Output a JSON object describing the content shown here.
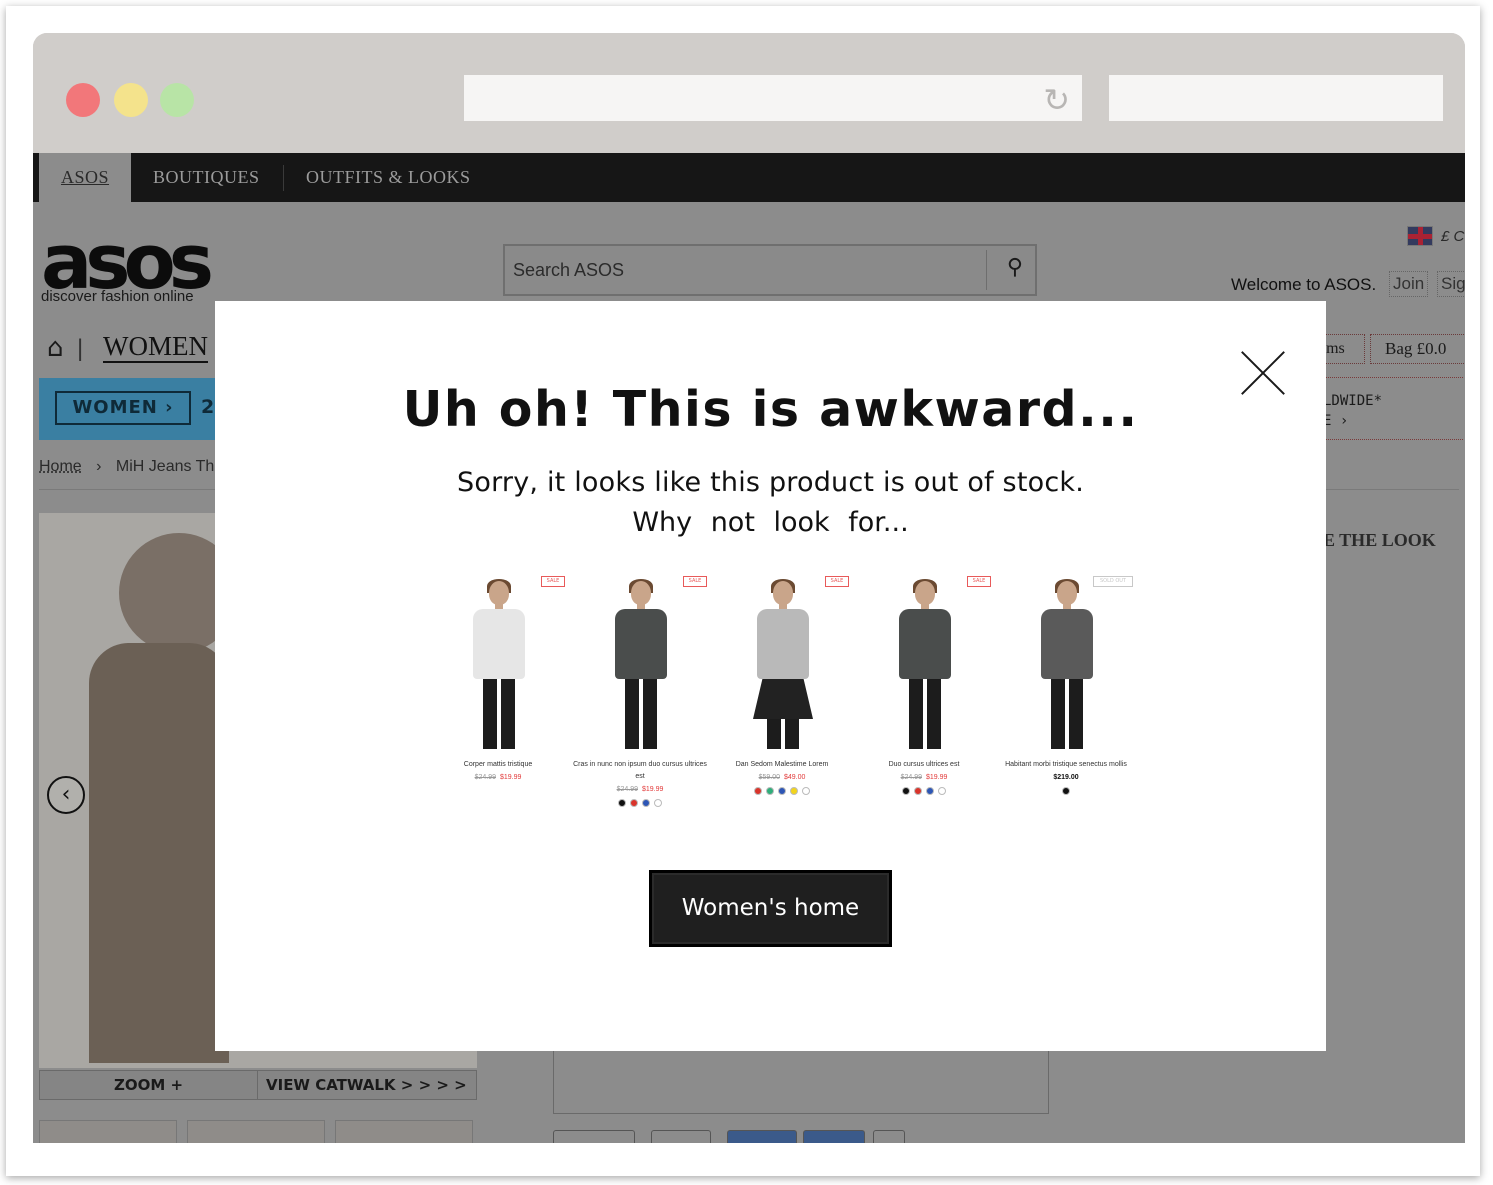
{
  "browser": {
    "reload_glyph": "↻"
  },
  "site": {
    "top_nav": [
      "ASOS",
      "BOUTIQUES",
      "OUTFITS & LOOKS"
    ],
    "logo": "asos",
    "tagline": "discover fashion online",
    "search_placeholder": "Search ASOS",
    "currency": "£ C",
    "welcome": "Welcome to ASOS.",
    "join": "Join",
    "sign_in": "Sig",
    "nav_women": "WOMEN",
    "banner_button": "WOMEN ›",
    "banner_number": "2",
    "breadcrumb": [
      "Home",
      "MiH Jeans The"
    ],
    "items_label": "ems",
    "bag_label": "Bag  £0.0",
    "shipping_line1": "LDWIDE*",
    "shipping_line2": "E ›",
    "shop_the_look": "E THE LOOK",
    "zoom_label": "ZOOM +",
    "catwalk_label": "VIEW CATWALK > > > >",
    "prev_arrow": "‹"
  },
  "modal": {
    "title": "Uh oh! This is awkward...",
    "subtitle_line1": "Sorry, it looks like this product is out of stock.",
    "subtitle_line2": "Why not look for...",
    "cta_label": "Women's home",
    "products": [
      {
        "name": "Corper mattis tristique",
        "old_price": "$24.99",
        "price": "$19.99",
        "tag": "SALE",
        "top_color": "#e6e6e6",
        "swatches": []
      },
      {
        "name": "Cras in nunc non ipsum duo cursus ultrices est",
        "old_price": "$24.99",
        "price": "$19.99",
        "tag": "SALE",
        "top_color": "#4a4d4c",
        "swatches": [
          "#111111",
          "#d9342b",
          "#2d56b5",
          "#ffffff"
        ]
      },
      {
        "name": "Dan Sedom Malestime Lorem",
        "old_price": "$59.00",
        "price": "$49.00",
        "tag": "SALE",
        "top_color": "#b9b9b9",
        "swatches": [
          "#d9342b",
          "#2fae7a",
          "#2d56b5",
          "#f2d41c",
          "#ffffff"
        ]
      },
      {
        "name": "Duo cursus ultrices est",
        "old_price": "$24.99",
        "price": "$19.99",
        "tag": "SALE",
        "top_color": "#4a4d4c",
        "swatches": [
          "#111111",
          "#d9342b",
          "#2d56b5",
          "#ffffff"
        ]
      },
      {
        "name": "Habitant morbi tristique senectus mollis",
        "old_price": "",
        "price": "$219.00",
        "tag": "SOLD OUT",
        "top_color": "#5a5a5a",
        "swatches": [
          "#111111"
        ]
      }
    ]
  },
  "colors": {
    "overlay": "#8c8c8c",
    "cta_bg": "#1f1f1f",
    "sale_red": "#e23a3a"
  }
}
